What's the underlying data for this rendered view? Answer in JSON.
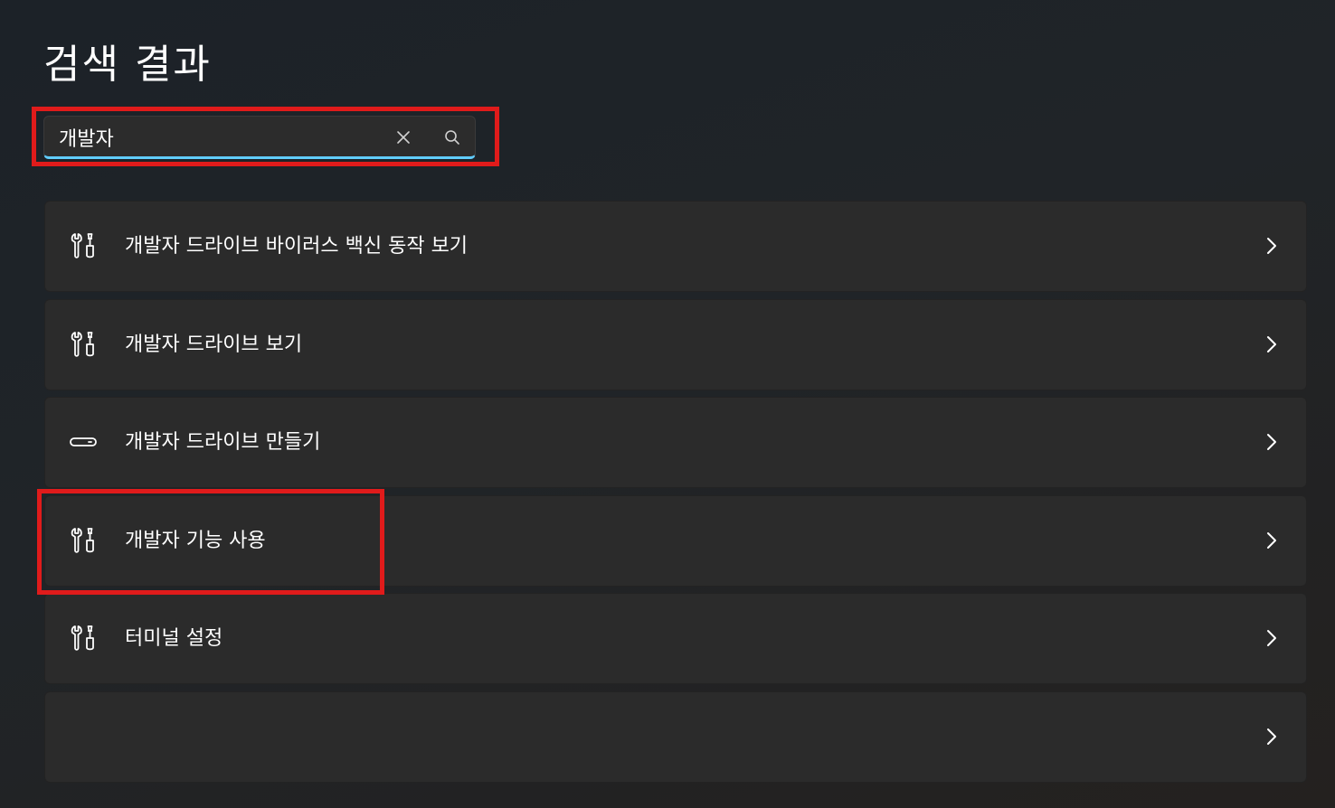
{
  "page": {
    "title": "검색 결과"
  },
  "search": {
    "value": "개발자"
  },
  "results": [
    {
      "label": "개발자 드라이브 바이러스 백신 동작 보기",
      "icon": "tools-icon"
    },
    {
      "label": "개발자 드라이브 보기",
      "icon": "tools-icon"
    },
    {
      "label": "개발자 드라이브 만들기",
      "icon": "drive-icon"
    },
    {
      "label": "개발자 기능 사용",
      "icon": "tools-icon"
    },
    {
      "label": "터미널 설정",
      "icon": "tools-icon"
    },
    {
      "label": "",
      "icon": ""
    }
  ],
  "colors": {
    "accent": "#60cdff",
    "highlight": "#e01b1b",
    "card": "#2b2b2b"
  }
}
